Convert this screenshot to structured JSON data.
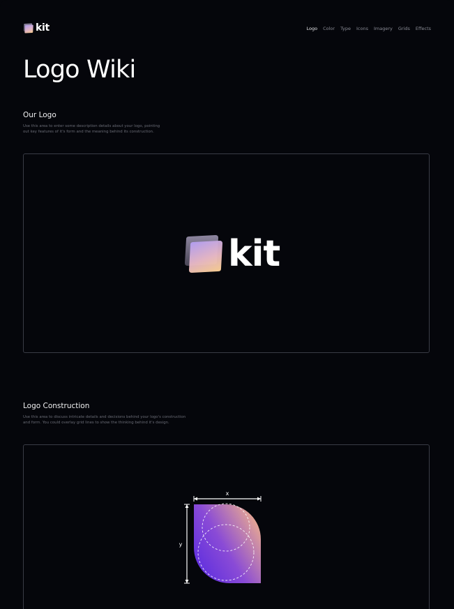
{
  "brand": {
    "name": "kit",
    "logo_icon": "kit-logo-icon"
  },
  "nav": {
    "items": [
      {
        "label": "Logo",
        "active": true
      },
      {
        "label": "Color",
        "active": false
      },
      {
        "label": "Type",
        "active": false
      },
      {
        "label": "Icons",
        "active": false
      },
      {
        "label": "Imagery",
        "active": false
      },
      {
        "label": "Grids",
        "active": false
      },
      {
        "label": "Effects",
        "active": false
      }
    ]
  },
  "page": {
    "title": "Logo Wiki"
  },
  "sections": {
    "our_logo": {
      "heading": "Our Logo",
      "description_line1": "Use this area to enter some description details about your logo, pointing",
      "description_line2": "out key features of it's form and the meaning behind its construction.",
      "logo_word": "kit"
    },
    "construction": {
      "heading": "Logo Construction",
      "description_line1": "Use this area to discuss intricate details and decisions behind your logo's construction",
      "description_line2": "and form. You could overlay grid lines to show the thinking behind it's design.",
      "dimension_x": "x",
      "dimension_y": "y"
    }
  },
  "colors": {
    "background": "#05060B",
    "panel_border": "#3a3c46",
    "gradient_purple": "#5B2CE0",
    "gradient_peach": "#F2B38A",
    "mark_back_top": "#8E86A0",
    "mark_back_bottom": "#4A4656",
    "mark_front_top": "#B7A0F0",
    "mark_front_bottom": "#FFD29A"
  }
}
